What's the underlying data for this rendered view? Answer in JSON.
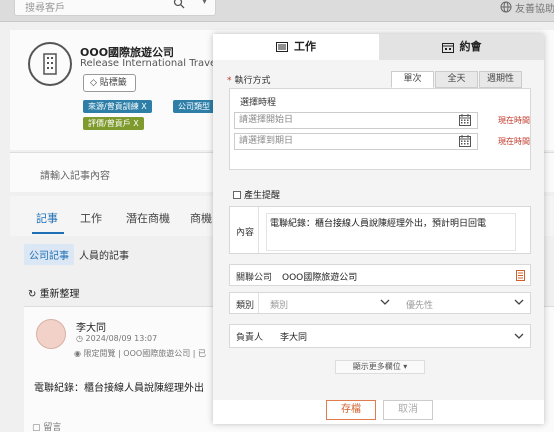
{
  "background": {
    "search": {
      "placeholder": "搜尋客戶"
    },
    "friends_label": "友善協助",
    "company": {
      "name": "OOO國際旅遊公司",
      "english_name": "Release International Travel",
      "tag_button": "貼標籤",
      "badges": [
        "來源/曾貢訓練 X",
        "公司類型",
        "評價/曾貢戶 X"
      ]
    },
    "note_placeholder": "請輸入記事內容",
    "tabs": [
      "記事",
      "工作",
      "潛在商機",
      "商機"
    ],
    "subtabs": [
      "公司記事",
      "人員的記事"
    ],
    "reorganize": "重新整理",
    "post": {
      "author": "李大同",
      "time": "2024/08/09 13:07",
      "meta": "限定閱覽 | OOO國際旅遊公司 | 已",
      "content": "電聯紀錄：櫃台接線人員說陳經理外出",
      "comment": "留言"
    }
  },
  "modal": {
    "tabs": {
      "work": "工作",
      "meeting": "約會"
    },
    "exec_method_label": "執行方式",
    "segments": [
      "單次",
      "全天",
      "週期性"
    ],
    "select_time_label": "選擇時程",
    "start_date_placeholder": "請選擇開始日",
    "end_date_placeholder": "請選擇到期日",
    "now_time_label": "現在時間",
    "reminder_label": "產生提醒",
    "content_label": "內容",
    "content_value": "電聯紀錄：櫃台接線人員說陳經理外出，預計明日回電",
    "related_company_label": "關聯公司",
    "related_company_value": "OOO國際旅遊公司",
    "category_label": "類別",
    "category_placeholder": "類別",
    "priority_placeholder": "優先性",
    "owner_label": "負責人",
    "owner_value": "李大同",
    "show_more": "顯示更多欄位",
    "save_button": "存檔",
    "cancel_button": "取消"
  },
  "colors": {
    "accent_red": "#c0392b",
    "save_orange": "#d2602e",
    "link_blue": "#1f6fb5"
  }
}
